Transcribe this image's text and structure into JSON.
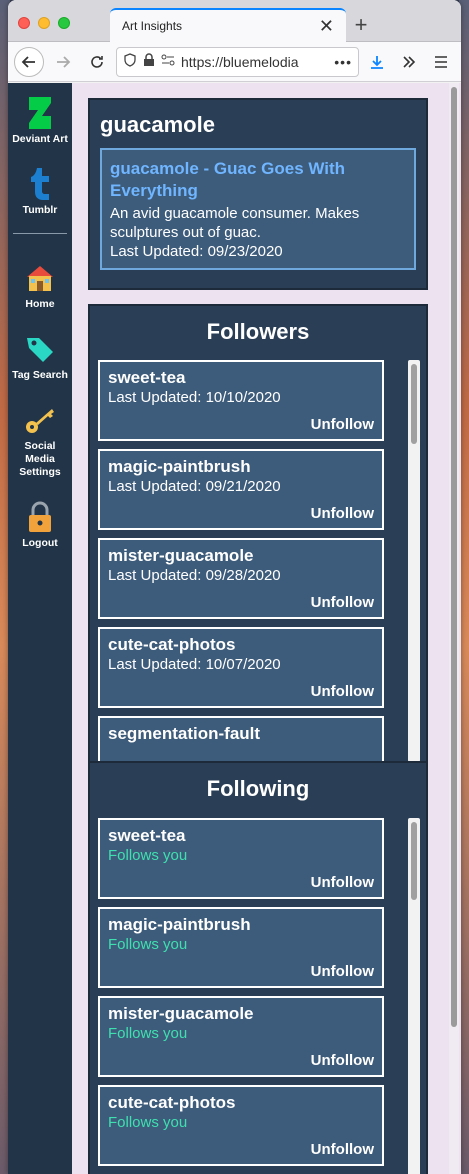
{
  "browser": {
    "tab_title": "Art Insights",
    "tab_close": "✕",
    "new_tab": "+",
    "url": "https://bluemelodia",
    "url_more": "•••"
  },
  "sidebar": {
    "items": [
      {
        "label": "Deviant Art",
        "icon": "deviantart-icon"
      },
      {
        "label": "Tumblr",
        "icon": "tumblr-icon"
      },
      {
        "label": "Home",
        "icon": "house-icon"
      },
      {
        "label": "Tag Search",
        "icon": "tag-icon"
      },
      {
        "label": "Social Media Settings",
        "icon": "key-icon"
      },
      {
        "label": "Logout",
        "icon": "lock-icon"
      }
    ]
  },
  "profile": {
    "name": "guacamole",
    "title": "guacamole - Guac Goes With Everything",
    "description": "An avid guacamole consumer. Makes sculptures out of guac.",
    "last_updated": "Last Updated: 09/23/2020"
  },
  "followers": {
    "title": "Followers",
    "items": [
      {
        "name": "sweet-tea",
        "sub": "Last Updated: 10/10/2020",
        "action": "Unfollow"
      },
      {
        "name": "magic-paintbrush",
        "sub": "Last Updated: 09/21/2020",
        "action": "Unfollow"
      },
      {
        "name": "mister-guacamole",
        "sub": "Last Updated: 09/28/2020",
        "action": "Unfollow"
      },
      {
        "name": "cute-cat-photos",
        "sub": "Last Updated: 10/07/2020",
        "action": "Unfollow"
      },
      {
        "name": "segmentation-fault",
        "sub": "",
        "action": ""
      }
    ]
  },
  "following": {
    "title": "Following",
    "items": [
      {
        "name": "sweet-tea",
        "sub": "Follows you",
        "action": "Unfollow"
      },
      {
        "name": "magic-paintbrush",
        "sub": "Follows you",
        "action": "Unfollow"
      },
      {
        "name": "mister-guacamole",
        "sub": "Follows you",
        "action": "Unfollow"
      },
      {
        "name": "cute-cat-photos",
        "sub": "Follows you",
        "action": "Unfollow"
      }
    ]
  },
  "colors": {
    "sidebar_bg": "#223447",
    "card_bg": "#2a3e55",
    "item_bg": "#3d5b7a",
    "link_blue": "#6fb5ff",
    "follows_green": "#3ee0b0"
  }
}
